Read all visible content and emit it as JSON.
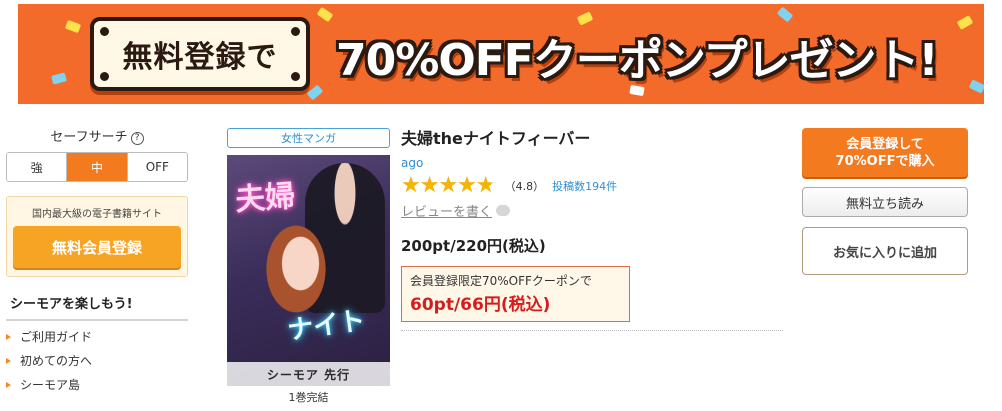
{
  "banner": {
    "plate_text": "無料登録で",
    "headline": "70%OFFクーポンプレゼント!",
    "colors": {
      "background": "#f36b2a",
      "outline": "#2a1a12",
      "plate": "#fff8e6"
    }
  },
  "safe_search": {
    "title": "セーフサーチ",
    "help_icon": "question-circle-icon",
    "options": [
      "強",
      "中",
      "OFF"
    ],
    "selected": "中"
  },
  "signup_box": {
    "caption": "国内最大級の電子書籍サイト",
    "button": "無料会員登録"
  },
  "sidebar": {
    "heading": "シーモアを楽しもう!",
    "links": [
      "ご利用ガイド",
      "初めての方へ",
      "シーモア島"
    ]
  },
  "book": {
    "genre": "女性マンガ",
    "cover_neon_top": "夫婦",
    "cover_neon_bottom": "ナイト",
    "cover_brand": "シーモア 先行",
    "volume_note": "1巻完結",
    "title": "夫婦theナイトフィーバー",
    "author": "ago",
    "rating": 4.8,
    "rating_text": "（4.8）",
    "reviews_link": "投稿数194件",
    "write_review": "レビューを書く",
    "price": "200pt/220円(税込)",
    "coupon_caption": "会員登録限定70%OFFクーポンで",
    "coupon_price": "60pt/66円(税込)"
  },
  "actions": {
    "buy_line1": "会員登録して",
    "buy_line2": "70%OFFで購入",
    "trial": "無料立ち読み",
    "favorite": "お気に入りに追加"
  },
  "colors": {
    "accent": "#f47a1f",
    "link": "#2f8fd0",
    "star": "#f5b400",
    "coupon_price": "#d51d1d"
  }
}
